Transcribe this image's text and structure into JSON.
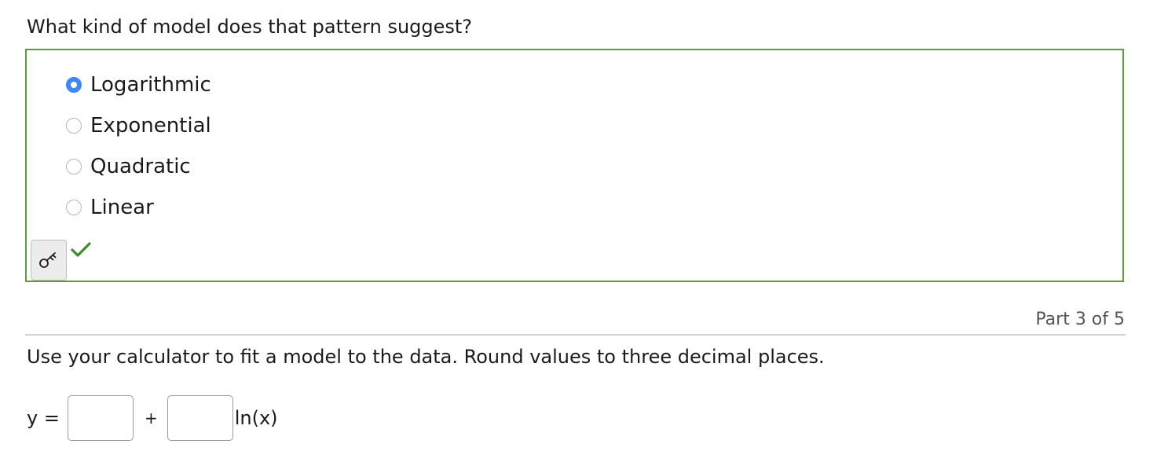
{
  "question": {
    "text": "What kind of model does that pattern suggest?"
  },
  "choices": {
    "options": [
      {
        "label": "Logarithmic",
        "selected": true
      },
      {
        "label": "Exponential",
        "selected": false
      },
      {
        "label": "Quadratic",
        "selected": false
      },
      {
        "label": "Linear",
        "selected": false
      }
    ]
  },
  "status": {
    "key_icon": "key-icon",
    "check_icon": "checkmark-icon",
    "correct_color": "#5b9e38"
  },
  "part": {
    "label": "Part 3 of 5"
  },
  "instruction": {
    "text": "Use your calculator to fit a model to the data. Round values to three decimal places."
  },
  "equation": {
    "lhs": "y =",
    "plus": "+",
    "suffix": "ln(x)",
    "input_a": "",
    "input_b": ""
  },
  "colors": {
    "accent": "#3f87f5",
    "border_correct": "#5b9e38",
    "divider": "#d2d2d2"
  }
}
